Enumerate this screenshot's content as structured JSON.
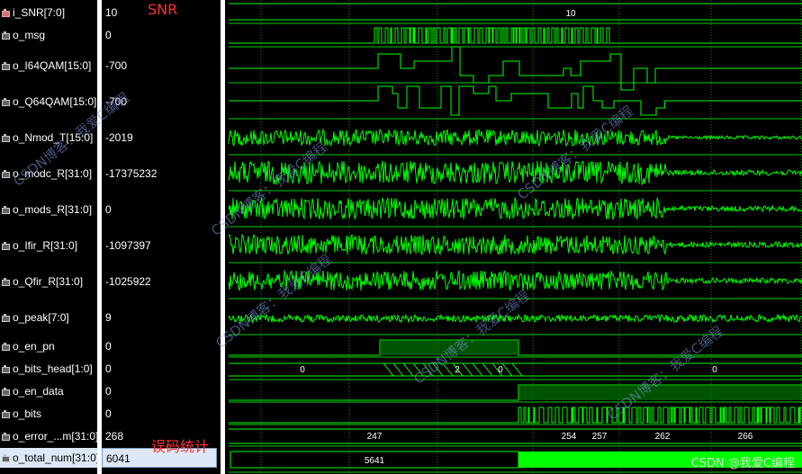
{
  "signals": [
    {
      "name": "i_SNR[7:0]",
      "value": "10",
      "kind": "in"
    },
    {
      "name": "o_msg",
      "value": "0",
      "kind": "out"
    },
    {
      "name": "o_I64QAM[15:0]",
      "value": "-700",
      "kind": "out"
    },
    {
      "name": "o_Q64QAM[15:0]",
      "value": "-700",
      "kind": "out"
    },
    {
      "name": "o_Nmod_T[15:0]",
      "value": "-2019",
      "kind": "out"
    },
    {
      "name": "o_modc_R[31:0]",
      "value": "-17375232",
      "kind": "out"
    },
    {
      "name": "o_mods_R[31:0]",
      "value": "0",
      "kind": "out"
    },
    {
      "name": "o_Ifir_R[31:0]",
      "value": "-1097397",
      "kind": "out"
    },
    {
      "name": "o_Qfir_R[31:0]",
      "value": "-1025922",
      "kind": "out"
    },
    {
      "name": "o_peak[7:0]",
      "value": "9",
      "kind": "out"
    },
    {
      "name": "o_en_pn",
      "value": "0",
      "kind": "out"
    },
    {
      "name": "o_bits_head[1:0]",
      "value": "0",
      "kind": "out"
    },
    {
      "name": "o_en_data",
      "value": "0",
      "kind": "out"
    },
    {
      "name": "o_bits",
      "value": "0",
      "kind": "out"
    },
    {
      "name": "o_error_...m[31:0]",
      "value": "268",
      "kind": "out"
    },
    {
      "name": "o_total_num[31:0]",
      "value": "6041",
      "kind": "out",
      "selected": true
    }
  ],
  "annotations": {
    "snr": "SNR",
    "ber": "误码统计"
  },
  "waveform": {
    "snr_label": "10",
    "bits_head_labels": [
      "0",
      "2",
      "0",
      "0"
    ],
    "error_labels": [
      "247",
      "254",
      "257",
      "262",
      "266"
    ],
    "total_label": "5641"
  },
  "watermark": "CSDN博客：我爱C编程",
  "footer": "CSDN @我爱C编程",
  "colors": {
    "wave": "#00ff00",
    "grid": "#00d000",
    "selected": "#dde7f5"
  }
}
